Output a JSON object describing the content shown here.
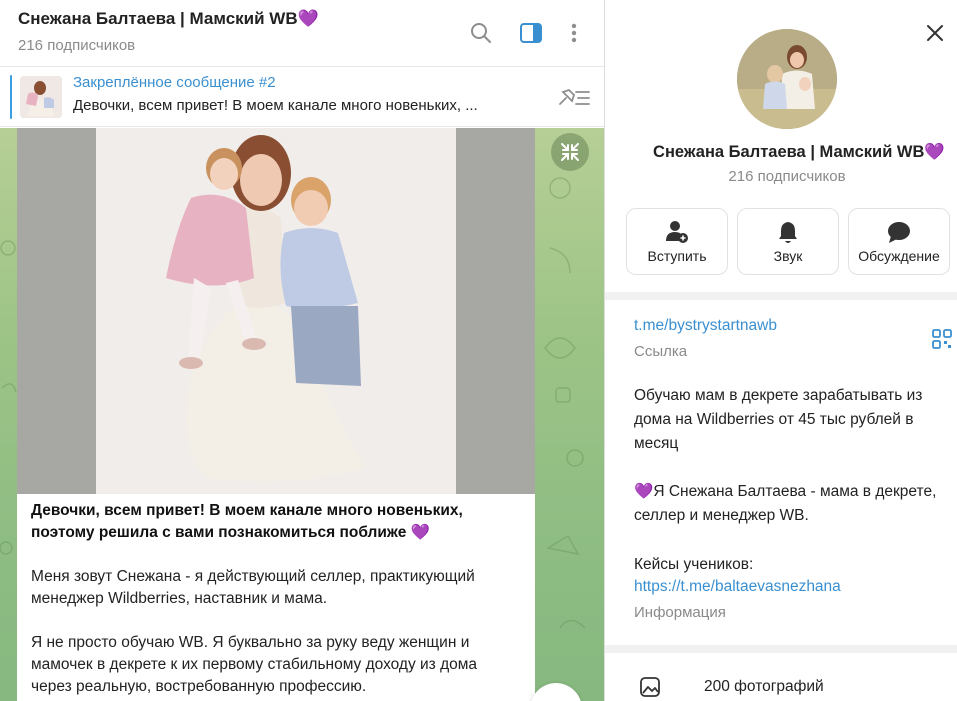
{
  "chat": {
    "title": "Снежана Балтаева | Мамский WB",
    "title_emoji": "💜",
    "subscribers": "216 подписчиков"
  },
  "pinned": {
    "title": "Закреплённое сообщение #2",
    "text": "Девочки, всем привет! В моем канале много новеньких, ..."
  },
  "message": {
    "headline": "Девочки, всем привет! В моем канале много новеньких, поэтому решила с вами познакомиться поближе",
    "headline_emoji": "💜",
    "paragraph1": "Меня зовут Снежана - я действующий селлер, практикующий менеджер Wildberries, наставник и мама.",
    "paragraph2": "Я не просто обучаю WB. Я буквально за руку веду женщин и мамочек в декрете к их первому стабильному доходу из дома через реальную, востребованную профессию."
  },
  "panel": {
    "name": "Снежана Балтаева | Мамский WB",
    "name_emoji": "💜",
    "subscribers": "216 подписчиков",
    "actions": [
      {
        "label": "Вступить",
        "icon": "add-user-icon"
      },
      {
        "label": "Звук",
        "icon": "bell-icon"
      },
      {
        "label": "Обсуждение",
        "icon": "chat-bubble-icon"
      }
    ],
    "link": "t.me/bystrystartnawb",
    "link_caption": "Ссылка",
    "about": "Обучаю мам в декрете зарабатывать из дома на Wildberries  от 45 тыс рублей в месяц",
    "about_emoji": "💜",
    "about2": "Я Снежана Балтаева - мама в декрете, селлер и менеджер WB.",
    "cases_label": "Кейсы учеников:",
    "cases_link": "https://t.me/baltaevasnezhana",
    "info_caption": "Информация",
    "photos": "200 фотографий"
  },
  "colors": {
    "accent": "#3a8fd0",
    "heart": "#9b46e0",
    "wallpaper": "#9ec487"
  }
}
